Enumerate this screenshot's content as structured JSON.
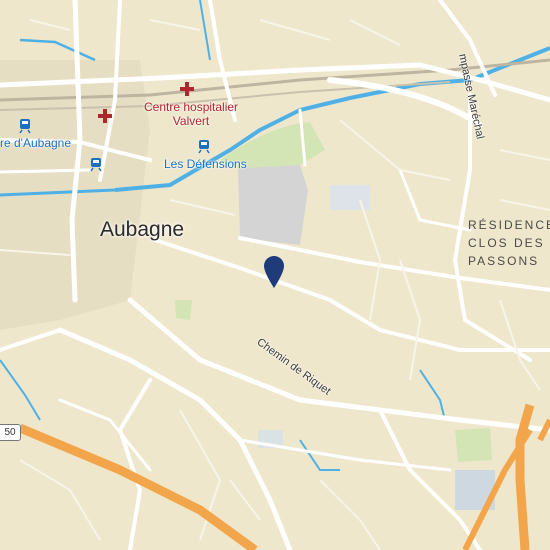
{
  "map": {
    "city_label": "Aubagne",
    "hospital_label": [
      "Centre hospitalier",
      "Valvert"
    ],
    "tram_stop_label": "Les Défensions",
    "station_label": "re d'Aubagne",
    "road_label": "Chemin de Riquet",
    "street_label_top": "mpasse Maréchal",
    "district_label": [
      "RÉSIDENCE",
      "CLOS DES",
      "PASSONS"
    ],
    "route_shield": "50",
    "colors": {
      "land": "#efe7cc",
      "water": "#4fb0e6",
      "motorway": "#f2a54a",
      "roads": "#ffffff",
      "parking": "#d3d3d3",
      "park": "#cfe3b3",
      "marker": "#1f3b7a",
      "hospital": "#b0262d",
      "transit": "#1f6fc0"
    },
    "icons": [
      "hospital-cross-icon",
      "train-station-icon",
      "tram-stop-icon",
      "location-pin-icon"
    ]
  }
}
